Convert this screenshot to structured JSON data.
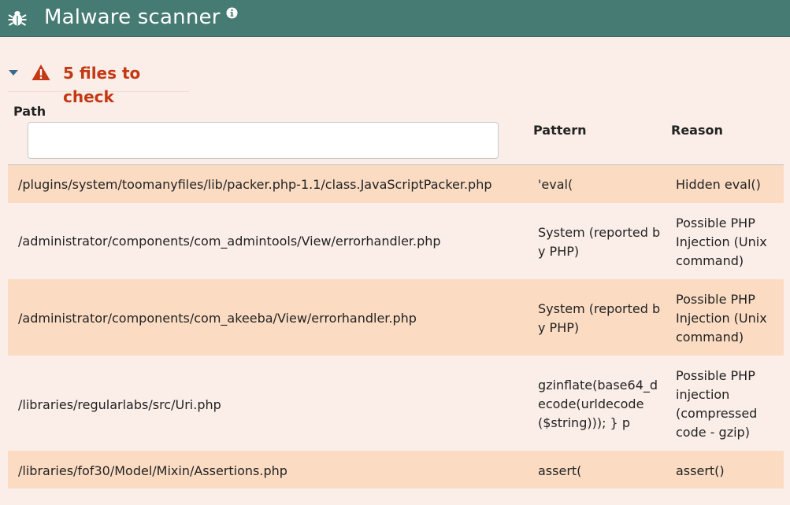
{
  "header": {
    "title": "Malware scanner",
    "icon": "bug-icon",
    "info_icon": "info-icon"
  },
  "section": {
    "title": "5 files to check",
    "expanded": true
  },
  "table": {
    "columns": {
      "path": "Path",
      "pattern": "Pattern",
      "reason": "Reason"
    },
    "path_filter_value": "",
    "rows": [
      {
        "path": "/plugins/system/toomanyfiles/lib/packer.php-1.1/class.JavaScriptPacker.php",
        "pattern": "'eval(",
        "reason": "Hidden eval()"
      },
      {
        "path": "/administrator/components/com_admintools/View/errorhandler.php",
        "pattern": "System (reported by PHP)",
        "reason": "Possible PHP Injection (Unix command)"
      },
      {
        "path": "/administrator/components/com_akeeba/View/errorhandler.php",
        "pattern": "System (reported by PHP)",
        "reason": "Possible PHP Injection (Unix command)"
      },
      {
        "path": "/libraries/regularlabs/src/Uri.php",
        "pattern": "gzinflate(base64_decode(urldecode($string))); } p",
        "reason": "Possible PHP injection (compressed code - gzip)"
      },
      {
        "path": "/libraries/fof30/Model/Mixin/Assertions.php",
        "pattern": "assert(",
        "reason": "assert()"
      }
    ]
  },
  "colors": {
    "header_bg": "#457b73",
    "warning": "#c43813",
    "row_shade": "#fbdcc3",
    "page_bg": "#fbeee8"
  }
}
